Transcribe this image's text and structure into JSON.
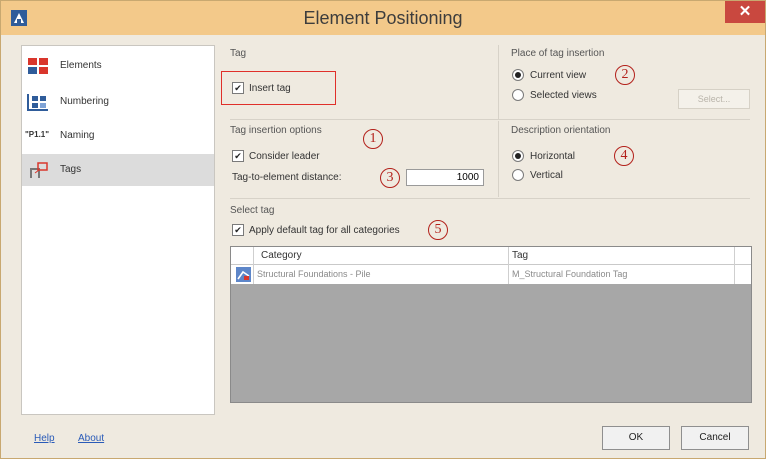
{
  "window": {
    "title": "Element Positioning",
    "close_label": "✕"
  },
  "sidebar": {
    "items": [
      {
        "label": "Elements",
        "icon": "elements-icon"
      },
      {
        "label": "Numbering",
        "icon": "numbering-icon"
      },
      {
        "label": "Naming",
        "icon": "naming-icon",
        "prefix": "\"P1.1\""
      },
      {
        "label": "Tags",
        "icon": "tags-icon",
        "active": true
      }
    ]
  },
  "tag_group": {
    "title": "Tag",
    "insert_tag_label": "Insert tag",
    "insert_tag_checked": true
  },
  "place_group": {
    "title": "Place of tag insertion",
    "current_view_label": "Current view",
    "selected_views_label": "Selected views",
    "selected": "current_view",
    "select_button_label": "Select..."
  },
  "options_group": {
    "title": "Tag insertion options",
    "consider_leader_label": "Consider leader",
    "consider_leader_checked": true,
    "distance_label": "Tag-to-element distance:",
    "distance_value": "1000"
  },
  "orientation_group": {
    "title": "Description orientation",
    "horizontal_label": "Horizontal",
    "vertical_label": "Vertical",
    "selected": "horizontal"
  },
  "select_tag_group": {
    "title": "Select tag",
    "apply_default_label": "Apply default tag for all categories",
    "apply_default_checked": true
  },
  "table": {
    "columns": [
      "Category",
      "Tag"
    ],
    "rows": [
      {
        "category": "Structural Foundations - Pile",
        "tag": "M_Structural Foundation Tag"
      }
    ]
  },
  "annotations": [
    "1",
    "2",
    "3",
    "4",
    "5"
  ],
  "footer": {
    "help_label": "Help",
    "about_label": "About",
    "ok_label": "OK",
    "cancel_label": "Cancel"
  },
  "colors": {
    "titlebar": "#f3c98a",
    "close": "#c9483f",
    "annotation": "#b3211b",
    "link": "#2a5bb8"
  }
}
